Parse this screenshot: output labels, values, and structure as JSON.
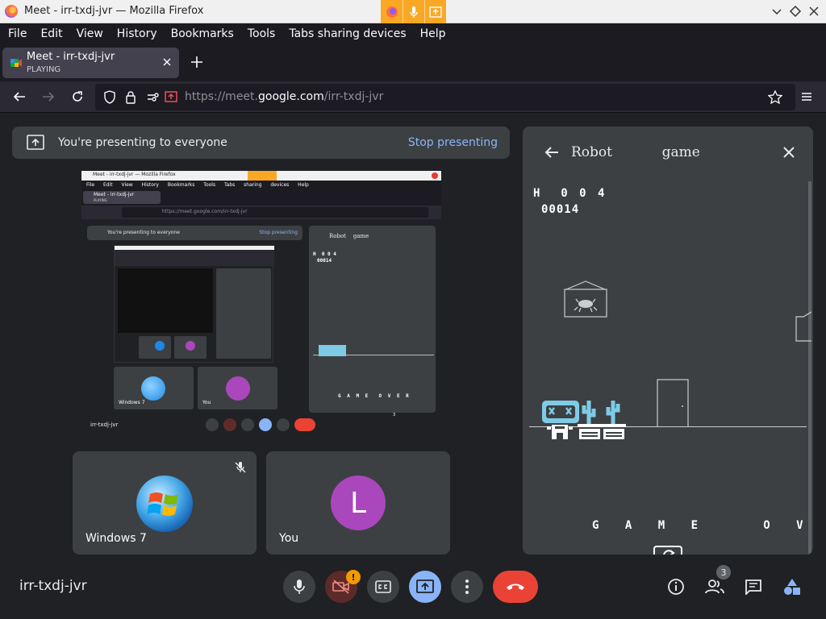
{
  "window": {
    "title": "Meet - irr-txdj-jvr — Mozilla Firefox"
  },
  "menu": [
    "File",
    "Edit",
    "View",
    "History",
    "Bookmarks",
    "Tools",
    "Tabs sharing devices",
    "Help"
  ],
  "tab": {
    "title": "Meet - irr-txdj-jvr",
    "status": "PLAYING"
  },
  "url": {
    "prefix": "https://meet.",
    "domain": "google.com",
    "path": "/irr-txdj-jvr"
  },
  "presenting": {
    "message": "You're presenting to everyone",
    "stop_label": "Stop presenting"
  },
  "preview": {
    "window_title": "Meet - irr-txdj-jvr — Mozilla Firefox",
    "tab_title": "Meet - irr-txdj-jvr",
    "tab_status": "PLAYING",
    "url": "https://meet.google.com/irr-txdj-jvr",
    "presenting_message": "You're presenting to everyone",
    "stop_label": "Stop presenting",
    "panel_title": "Robot    game",
    "hi_score": "H  0 0 4",
    "score": "00014",
    "game_over": "G A M E  O V E R",
    "tile1": "Windows 7",
    "tile2": "You",
    "meeting_code": "irr-txdj-jvr",
    "people_count": "3"
  },
  "participants": [
    {
      "name": "Windows 7",
      "muted": true
    },
    {
      "name": "You",
      "initial": "L",
      "avatar_color": "#ab47bc"
    }
  ],
  "panel": {
    "title": "Robot    game",
    "hi_score": "H  0 0 4",
    "score": "00014",
    "game_over": "G A M E   O V E R"
  },
  "meeting": {
    "code": "irr-txdj-jvr",
    "people_count": "3",
    "camera_alert": "!"
  },
  "colors": {
    "accent": "#8ab4f8",
    "danger": "#ea4335",
    "share_active": "#8ab4f8",
    "robot": "#7ecbe6"
  }
}
